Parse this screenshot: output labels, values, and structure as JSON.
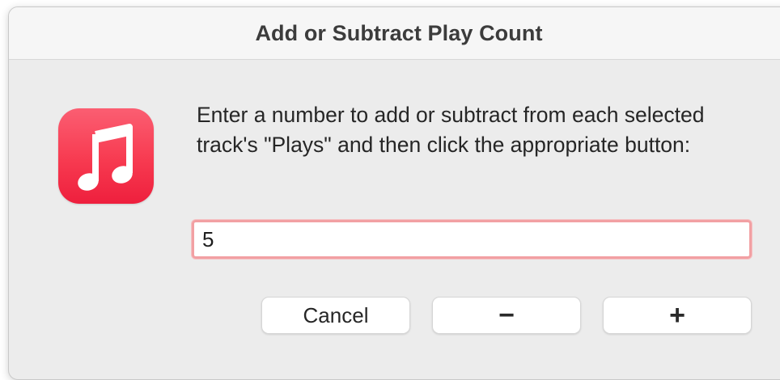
{
  "dialog": {
    "title": "Add or Subtract Play Count",
    "app_icon": "music-note-icon",
    "accent_color": "#f73a50",
    "message": "Enter a number to add or subtract from each selected track's \"Plays\" and then click the appropriate button:",
    "input": {
      "value": "5"
    },
    "buttons": {
      "cancel": "Cancel",
      "subtract": "−",
      "add": "+"
    }
  }
}
